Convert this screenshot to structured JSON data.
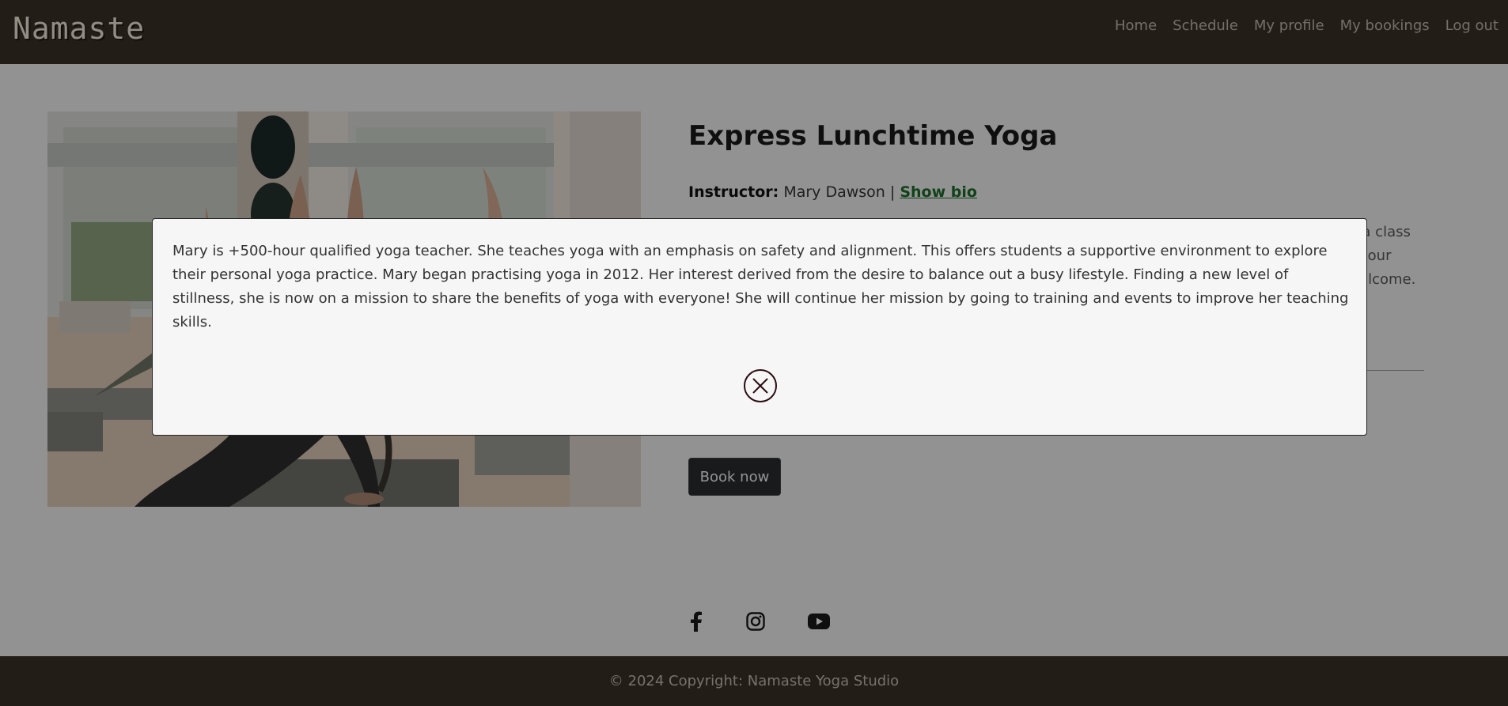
{
  "header": {
    "brand": "Namaste",
    "nav": [
      "Home",
      "Schedule",
      "My profile",
      "My bookings",
      "Log out"
    ]
  },
  "class": {
    "title": "Express Lunchtime Yoga",
    "instructor_label": "Instructor:",
    "instructor_name": "Mary Dawson",
    "separator": "|",
    "show_bio_label": "Show bio",
    "description_fragments": [
      "ga class",
      "your",
      "elcome."
    ],
    "book_button": "Book now",
    "image_icon": "yoga-class-photo"
  },
  "modal": {
    "bio_text": "Mary is +500-hour qualified yoga teacher. She teaches yoga with an emphasis on safety and alignment. This offers students a supportive environment to explore their personal yoga practice. Mary began practising yoga in 2012. Her interest derived from the desire to balance out a busy lifestyle. Finding a new level of stillness, she is now on a mission to share the benefits of yoga with everyone! She will continue her mission by going to training and events to improve her teaching skills.",
    "close_icon": "close-circle-icon"
  },
  "social": [
    "facebook-icon",
    "instagram-icon",
    "youtube-icon"
  ],
  "footer": {
    "copyright": "© 2024 Copyright: Namaste Yoga Studio"
  },
  "colors": {
    "header_bg": "#3a3028",
    "link_green": "#1c6b2a",
    "button_dark": "#2a2b2e",
    "overlay": "rgba(0,0,0,0.39)"
  }
}
